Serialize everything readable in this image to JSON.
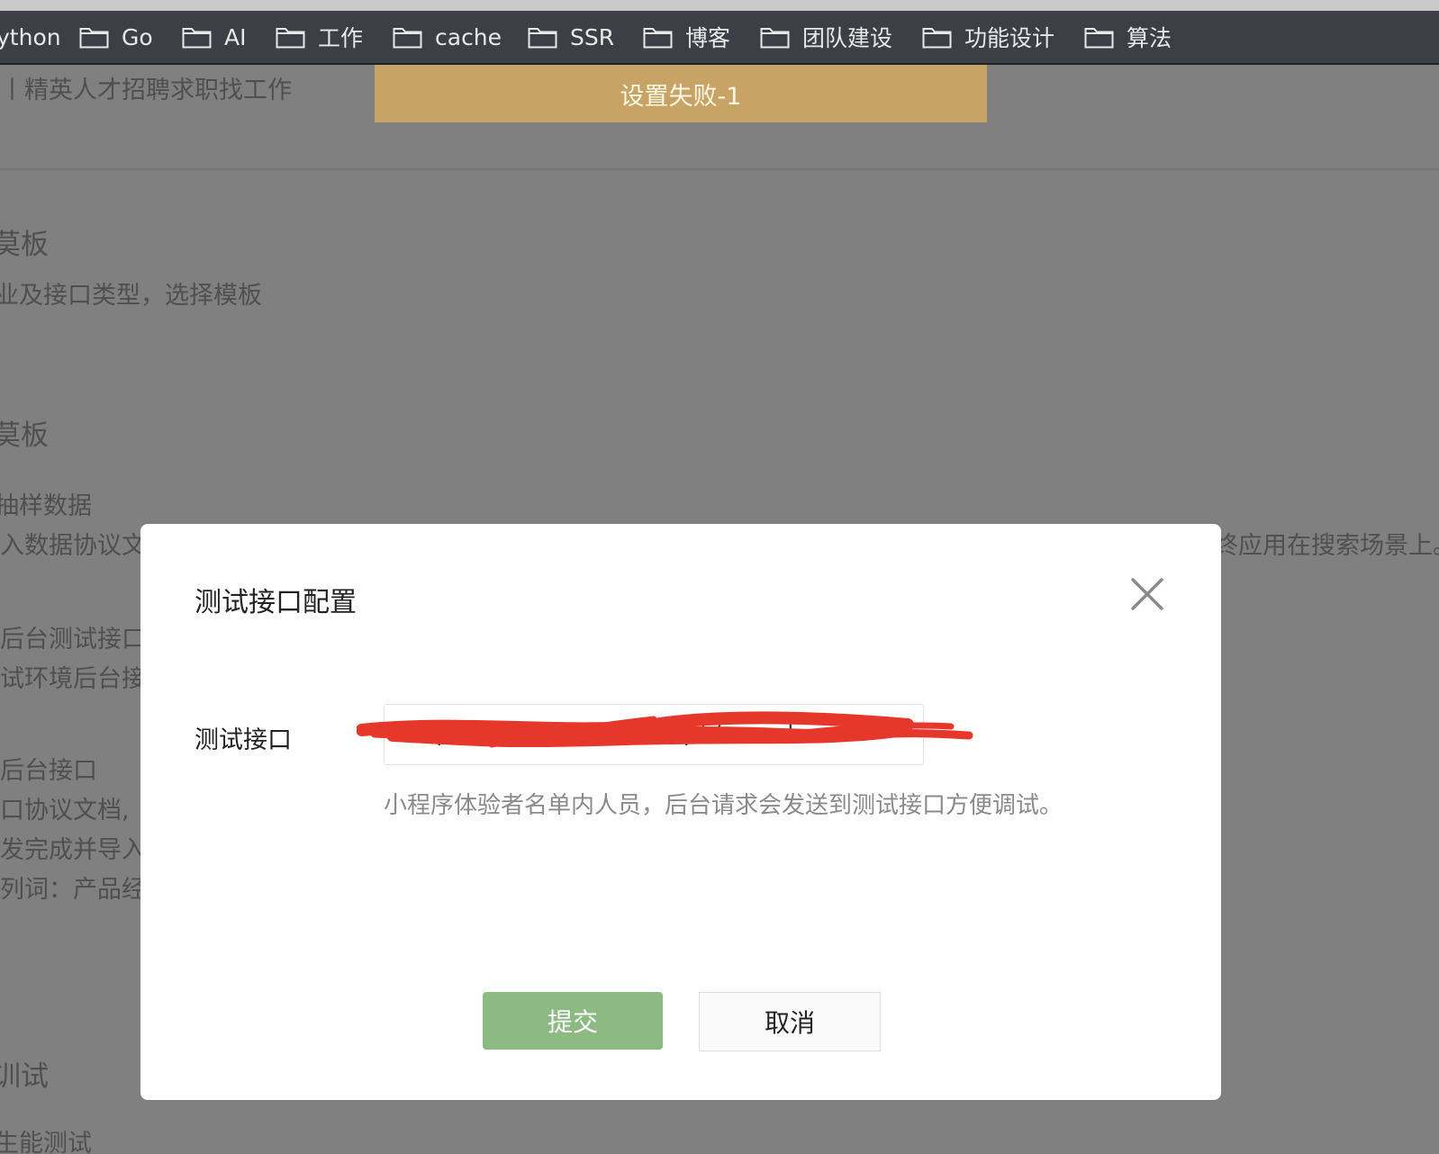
{
  "bookmarks": {
    "items": [
      {
        "label": "ython"
      },
      {
        "label": "Go"
      },
      {
        "label": "AI"
      },
      {
        "label": "工作"
      },
      {
        "label": "cache"
      },
      {
        "label": "SSR"
      },
      {
        "label": "博客"
      },
      {
        "label": "团队建设"
      },
      {
        "label": "功能设计"
      },
      {
        "label": "算法"
      }
    ]
  },
  "toast": {
    "message": "设置失败-1"
  },
  "background_page": {
    "site_title": "丨精英人才招聘求职找工作",
    "section1_heading": "莫板",
    "section1_desc": "业及接口类型，选择模板",
    "section2_heading": "莫板",
    "line_sample": "抽样数据",
    "line_import_left": "入数据协议文",
    "line_import_right": "终应用在搜索场景上。",
    "line_test_api": "后台测试接口",
    "line_test_env": "试环境后台接",
    "line_backend_api": "后台接口",
    "line_api_doc": "口协议文档,",
    "line_dev_done": "发完成并导入",
    "line_example": "列词：产品经",
    "section3_heading": "训试",
    "line_perf": "生能测试"
  },
  "modal": {
    "title": "测试接口配置",
    "field_label": "测试接口",
    "field_value": "http://test.xxxx.com/api/search",
    "hint": "小程序体验者名单内人员，后台请求会发送到测试接口方便调试。",
    "submit_label": "提交",
    "cancel_label": "取消"
  },
  "colors": {
    "toast_bg": "#c7a466",
    "submit_bg": "#8cba82",
    "redaction": "#e5382a",
    "overlay": "#808080"
  }
}
